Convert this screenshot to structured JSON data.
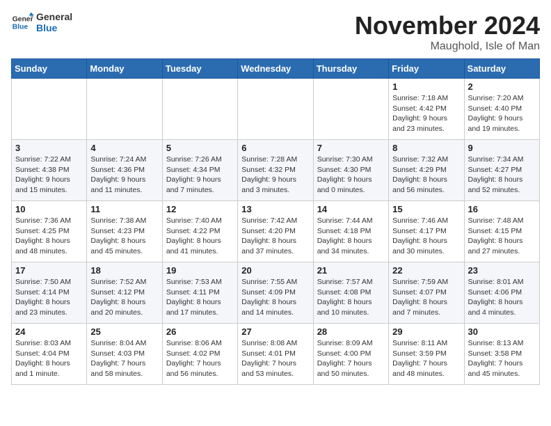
{
  "header": {
    "logo_line1": "General",
    "logo_line2": "Blue",
    "title": "November 2024",
    "location": "Maughold, Isle of Man"
  },
  "days_of_week": [
    "Sunday",
    "Monday",
    "Tuesday",
    "Wednesday",
    "Thursday",
    "Friday",
    "Saturday"
  ],
  "weeks": [
    [
      {
        "day": "",
        "info": ""
      },
      {
        "day": "",
        "info": ""
      },
      {
        "day": "",
        "info": ""
      },
      {
        "day": "",
        "info": ""
      },
      {
        "day": "",
        "info": ""
      },
      {
        "day": "1",
        "info": "Sunrise: 7:18 AM\nSunset: 4:42 PM\nDaylight: 9 hours and 23 minutes."
      },
      {
        "day": "2",
        "info": "Sunrise: 7:20 AM\nSunset: 4:40 PM\nDaylight: 9 hours and 19 minutes."
      }
    ],
    [
      {
        "day": "3",
        "info": "Sunrise: 7:22 AM\nSunset: 4:38 PM\nDaylight: 9 hours and 15 minutes."
      },
      {
        "day": "4",
        "info": "Sunrise: 7:24 AM\nSunset: 4:36 PM\nDaylight: 9 hours and 11 minutes."
      },
      {
        "day": "5",
        "info": "Sunrise: 7:26 AM\nSunset: 4:34 PM\nDaylight: 9 hours and 7 minutes."
      },
      {
        "day": "6",
        "info": "Sunrise: 7:28 AM\nSunset: 4:32 PM\nDaylight: 9 hours and 3 minutes."
      },
      {
        "day": "7",
        "info": "Sunrise: 7:30 AM\nSunset: 4:30 PM\nDaylight: 9 hours and 0 minutes."
      },
      {
        "day": "8",
        "info": "Sunrise: 7:32 AM\nSunset: 4:29 PM\nDaylight: 8 hours and 56 minutes."
      },
      {
        "day": "9",
        "info": "Sunrise: 7:34 AM\nSunset: 4:27 PM\nDaylight: 8 hours and 52 minutes."
      }
    ],
    [
      {
        "day": "10",
        "info": "Sunrise: 7:36 AM\nSunset: 4:25 PM\nDaylight: 8 hours and 48 minutes."
      },
      {
        "day": "11",
        "info": "Sunrise: 7:38 AM\nSunset: 4:23 PM\nDaylight: 8 hours and 45 minutes."
      },
      {
        "day": "12",
        "info": "Sunrise: 7:40 AM\nSunset: 4:22 PM\nDaylight: 8 hours and 41 minutes."
      },
      {
        "day": "13",
        "info": "Sunrise: 7:42 AM\nSunset: 4:20 PM\nDaylight: 8 hours and 37 minutes."
      },
      {
        "day": "14",
        "info": "Sunrise: 7:44 AM\nSunset: 4:18 PM\nDaylight: 8 hours and 34 minutes."
      },
      {
        "day": "15",
        "info": "Sunrise: 7:46 AM\nSunset: 4:17 PM\nDaylight: 8 hours and 30 minutes."
      },
      {
        "day": "16",
        "info": "Sunrise: 7:48 AM\nSunset: 4:15 PM\nDaylight: 8 hours and 27 minutes."
      }
    ],
    [
      {
        "day": "17",
        "info": "Sunrise: 7:50 AM\nSunset: 4:14 PM\nDaylight: 8 hours and 23 minutes."
      },
      {
        "day": "18",
        "info": "Sunrise: 7:52 AM\nSunset: 4:12 PM\nDaylight: 8 hours and 20 minutes."
      },
      {
        "day": "19",
        "info": "Sunrise: 7:53 AM\nSunset: 4:11 PM\nDaylight: 8 hours and 17 minutes."
      },
      {
        "day": "20",
        "info": "Sunrise: 7:55 AM\nSunset: 4:09 PM\nDaylight: 8 hours and 14 minutes."
      },
      {
        "day": "21",
        "info": "Sunrise: 7:57 AM\nSunset: 4:08 PM\nDaylight: 8 hours and 10 minutes."
      },
      {
        "day": "22",
        "info": "Sunrise: 7:59 AM\nSunset: 4:07 PM\nDaylight: 8 hours and 7 minutes."
      },
      {
        "day": "23",
        "info": "Sunrise: 8:01 AM\nSunset: 4:06 PM\nDaylight: 8 hours and 4 minutes."
      }
    ],
    [
      {
        "day": "24",
        "info": "Sunrise: 8:03 AM\nSunset: 4:04 PM\nDaylight: 8 hours and 1 minute."
      },
      {
        "day": "25",
        "info": "Sunrise: 8:04 AM\nSunset: 4:03 PM\nDaylight: 7 hours and 58 minutes."
      },
      {
        "day": "26",
        "info": "Sunrise: 8:06 AM\nSunset: 4:02 PM\nDaylight: 7 hours and 56 minutes."
      },
      {
        "day": "27",
        "info": "Sunrise: 8:08 AM\nSunset: 4:01 PM\nDaylight: 7 hours and 53 minutes."
      },
      {
        "day": "28",
        "info": "Sunrise: 8:09 AM\nSunset: 4:00 PM\nDaylight: 7 hours and 50 minutes."
      },
      {
        "day": "29",
        "info": "Sunrise: 8:11 AM\nSunset: 3:59 PM\nDaylight: 7 hours and 48 minutes."
      },
      {
        "day": "30",
        "info": "Sunrise: 8:13 AM\nSunset: 3:58 PM\nDaylight: 7 hours and 45 minutes."
      }
    ]
  ]
}
